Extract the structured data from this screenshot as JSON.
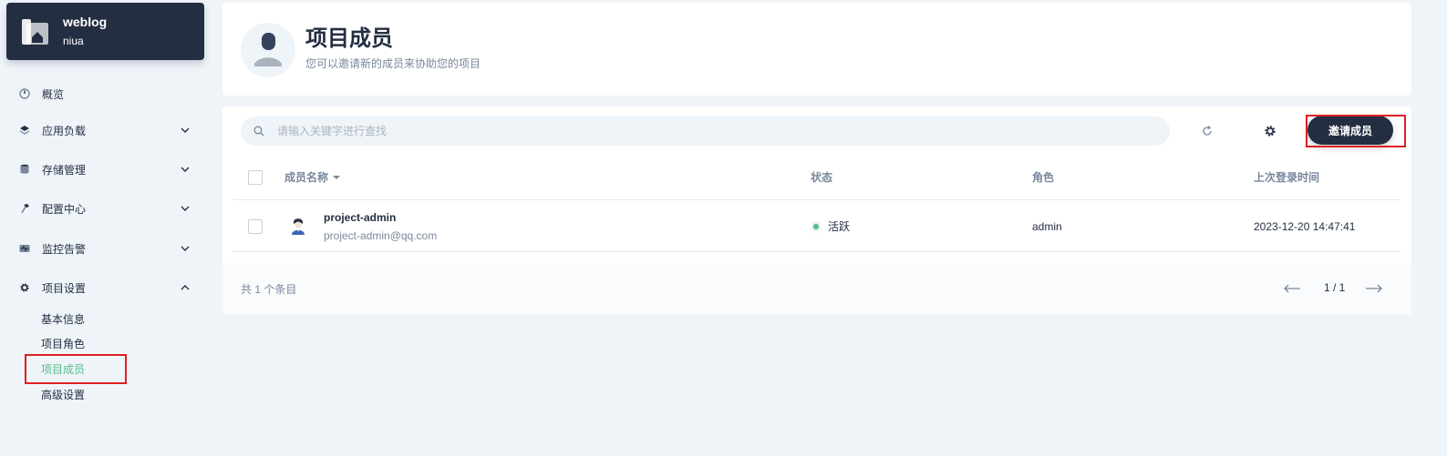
{
  "project": {
    "name": "weblog",
    "workspace": "niua"
  },
  "nav": {
    "overview": "概览",
    "workloads": "应用负载",
    "storage": "存储管理",
    "config": "配置中心",
    "monitoring": "监控告警",
    "settings": "项目设置",
    "settings_children": [
      "基本信息",
      "项目角色",
      "项目成员",
      "高级设置"
    ]
  },
  "header": {
    "title": "项目成员",
    "description": "您可以邀请新的成员来协助您的项目"
  },
  "toolbar": {
    "search_placeholder": "请输入关键字进行查找",
    "invite_label": "邀请成员"
  },
  "table": {
    "columns": [
      "成员名称",
      "状态",
      "角色",
      "上次登录时间"
    ],
    "rows": [
      {
        "name": "project-admin",
        "email": "project-admin@qq.com",
        "status": "活跃",
        "role": "admin",
        "last_login": "2023-12-20 14:47:41"
      }
    ]
  },
  "footer": {
    "total": "共 1 个条目",
    "page": "1 / 1"
  },
  "colors": {
    "primary_dark": "#242e42",
    "active_green": "#55bc8a",
    "highlight_red": "#e02020",
    "background": "#eff4f9"
  }
}
